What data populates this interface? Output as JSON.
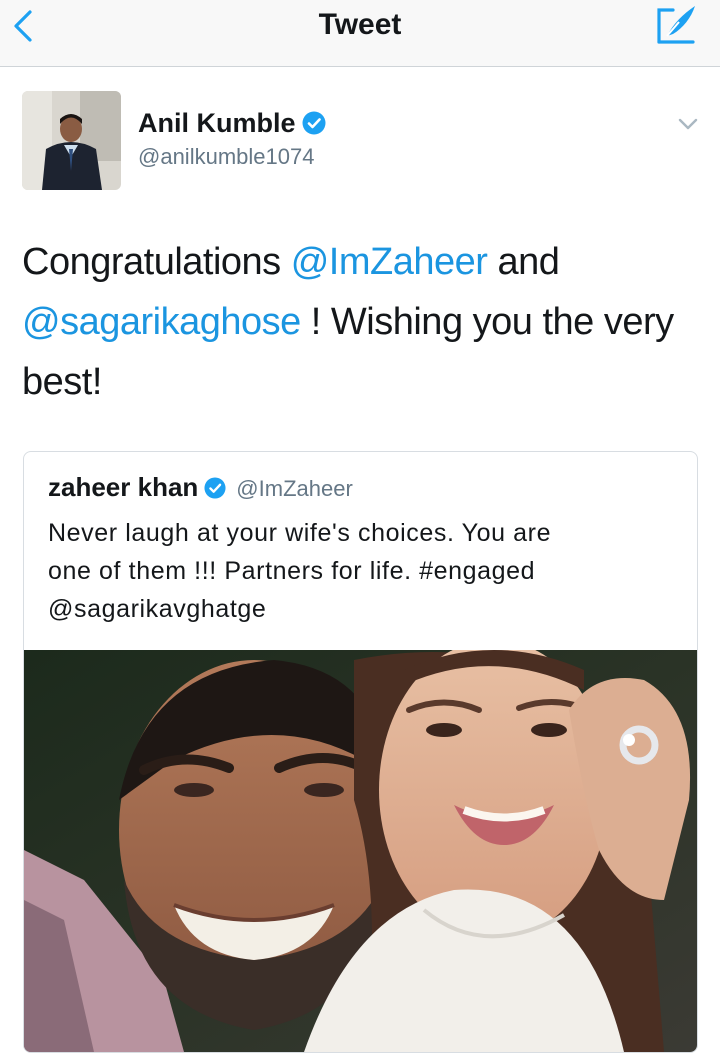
{
  "navbar": {
    "title": "Tweet",
    "back_icon": "chevron-left-icon",
    "compose_icon": "compose-icon"
  },
  "tweet": {
    "author": {
      "name": "Anil Kumble",
      "handle": "@anilkumble1074",
      "verified": true
    },
    "text_parts": [
      {
        "type": "text",
        "value": "Congratulations "
      },
      {
        "type": "mention",
        "value": "@ImZaheer"
      },
      {
        "type": "text",
        "value": " and "
      },
      {
        "type": "mention",
        "value": "@sagarikaghose"
      },
      {
        "type": "text",
        "value": " ! Wishing you the very best!"
      }
    ],
    "quote": {
      "author_name": "zaheer khan",
      "author_handle": "@ImZaheer",
      "verified": true,
      "text_lines": [
        "Never laugh at your wife's choices. You are",
        "one of them !!!  Partners for life. #engaged",
        "@sagarikavghatge"
      ]
    }
  },
  "colors": {
    "link": "#1b95e0",
    "text": "#14171a",
    "secondary": "#657786",
    "verified": "#1da1f2",
    "navbar_bg": "#f8f8f8"
  }
}
